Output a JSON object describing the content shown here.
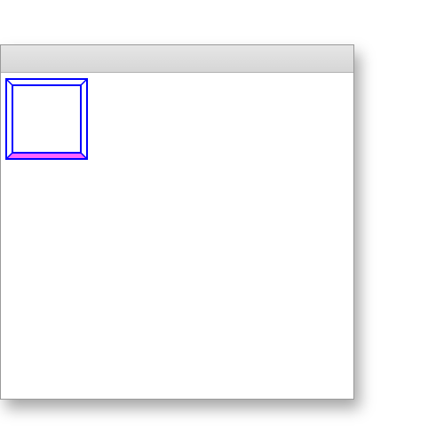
{
  "window": {
    "title": ""
  },
  "bevel_box": {
    "outline_color": "#0000ff",
    "face_color": "#ffffff",
    "bottom_bevel_color": "#ff66ff"
  }
}
